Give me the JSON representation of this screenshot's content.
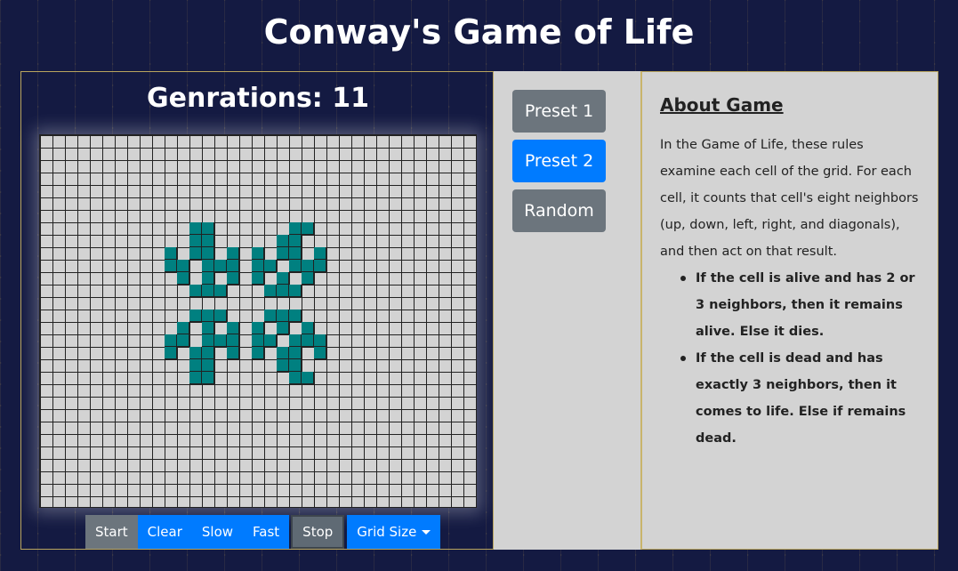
{
  "app": {
    "title": "Conway's Game of Life"
  },
  "game": {
    "generations_label": "Genrations: 11",
    "cell_color": "#008080",
    "grid_cols": 35,
    "grid_rows": 30,
    "live_cells": [
      [
        12,
        7
      ],
      [
        13,
        7
      ],
      [
        20,
        7
      ],
      [
        21,
        7
      ],
      [
        12,
        8
      ],
      [
        13,
        8
      ],
      [
        19,
        8
      ],
      [
        20,
        8
      ],
      [
        10,
        9
      ],
      [
        12,
        9
      ],
      [
        13,
        9
      ],
      [
        15,
        9
      ],
      [
        17,
        9
      ],
      [
        19,
        9
      ],
      [
        20,
        9
      ],
      [
        22,
        9
      ],
      [
        10,
        10
      ],
      [
        11,
        10
      ],
      [
        13,
        10
      ],
      [
        14,
        10
      ],
      [
        15,
        10
      ],
      [
        17,
        10
      ],
      [
        18,
        10
      ],
      [
        20,
        10
      ],
      [
        21,
        10
      ],
      [
        22,
        10
      ],
      [
        11,
        11
      ],
      [
        13,
        11
      ],
      [
        15,
        11
      ],
      [
        17,
        11
      ],
      [
        19,
        11
      ],
      [
        21,
        11
      ],
      [
        12,
        12
      ],
      [
        13,
        12
      ],
      [
        14,
        12
      ],
      [
        18,
        12
      ],
      [
        19,
        12
      ],
      [
        20,
        12
      ],
      [
        12,
        14
      ],
      [
        13,
        14
      ],
      [
        14,
        14
      ],
      [
        18,
        14
      ],
      [
        19,
        14
      ],
      [
        20,
        14
      ],
      [
        11,
        15
      ],
      [
        13,
        15
      ],
      [
        15,
        15
      ],
      [
        17,
        15
      ],
      [
        19,
        15
      ],
      [
        21,
        15
      ],
      [
        10,
        16
      ],
      [
        11,
        16
      ],
      [
        13,
        16
      ],
      [
        14,
        16
      ],
      [
        15,
        16
      ],
      [
        17,
        16
      ],
      [
        18,
        16
      ],
      [
        20,
        16
      ],
      [
        21,
        16
      ],
      [
        22,
        16
      ],
      [
        10,
        17
      ],
      [
        12,
        17
      ],
      [
        13,
        17
      ],
      [
        15,
        17
      ],
      [
        17,
        17
      ],
      [
        19,
        17
      ],
      [
        20,
        17
      ],
      [
        22,
        17
      ],
      [
        12,
        18
      ],
      [
        13,
        18
      ],
      [
        19,
        18
      ],
      [
        20,
        18
      ],
      [
        12,
        19
      ],
      [
        13,
        19
      ],
      [
        20,
        19
      ],
      [
        21,
        19
      ]
    ]
  },
  "controls": {
    "start": "Start",
    "clear": "Clear",
    "slow": "Slow",
    "fast": "Fast",
    "stop": "Stop",
    "grid_size": "Grid Size"
  },
  "presets": {
    "preset1": "Preset 1",
    "preset2": "Preset 2",
    "random": "Random"
  },
  "about": {
    "title": "About Game",
    "text": "In the Game of Life, these rules examine each cell of the grid. For each cell, it counts that cell's eight neighbors (up, down, left, right, and diagonals), and then act on that result.",
    "rules": [
      "If the cell is alive and has 2 or 3 neighbors, then it remains alive. Else it dies.",
      "If the cell is dead and has exactly 3 neighbors, then it comes to life. Else if remains dead."
    ]
  }
}
